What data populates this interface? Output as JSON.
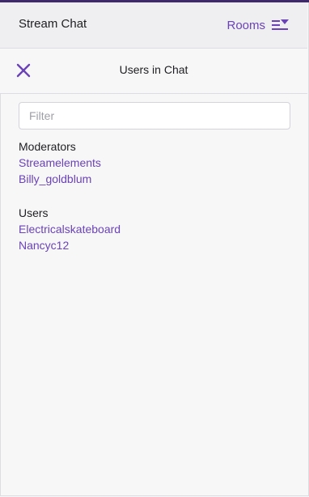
{
  "header": {
    "title": "Stream Chat",
    "rooms_label": "Rooms",
    "rooms_icon": "list-dropdown-icon"
  },
  "panel": {
    "title": "Users in Chat",
    "close_icon": "close-icon"
  },
  "filter": {
    "placeholder": "Filter",
    "value": ""
  },
  "moderators": {
    "heading": "Moderators",
    "users": [
      "Streamelements",
      "Billy_goldblum"
    ]
  },
  "users": {
    "heading": "Users",
    "users": [
      "Electricalskateboard",
      "Nancyc12"
    ]
  },
  "colors": {
    "accent": "#6a43b6",
    "top_bar": "#3f2a6b",
    "background": "#f7f7f8",
    "header_background": "#efeff1"
  }
}
